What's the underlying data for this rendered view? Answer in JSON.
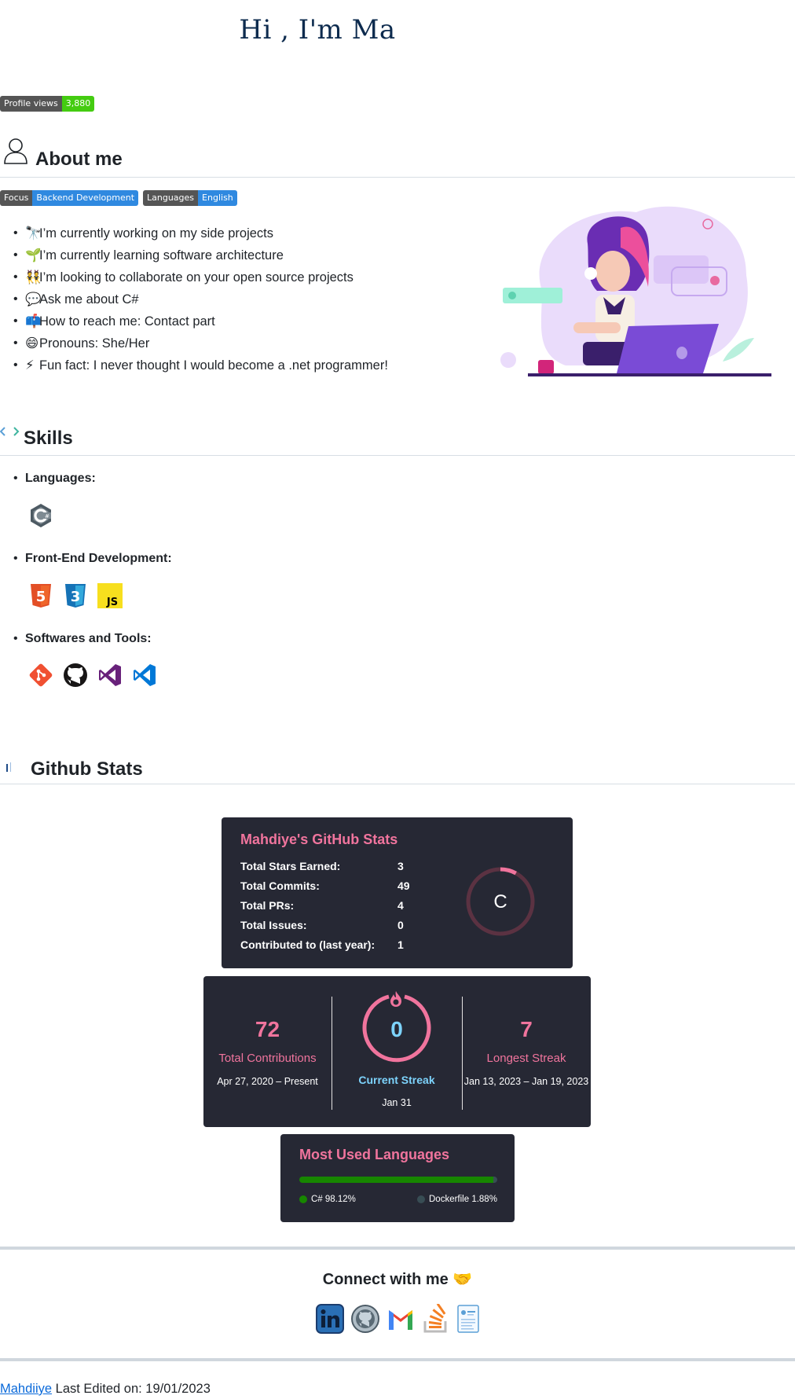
{
  "header": {
    "title": "Hi , I'm Ma"
  },
  "badges": {
    "views_label": "Profile views",
    "views_value": "3,880",
    "focus_label": "Focus",
    "focus_value": "Backend Development",
    "lang_label": "Languages",
    "lang_value": "English"
  },
  "about": {
    "heading": "About me",
    "items": [
      {
        "emoji": "🔭",
        "text": "I’m currently working on my side projects"
      },
      {
        "emoji": "🌱",
        "text": "I’m currently learning software architecture"
      },
      {
        "emoji": "👯",
        "text": "I’m looking to collaborate on your open source projects"
      },
      {
        "emoji": "💬",
        "text": "Ask me about C#"
      },
      {
        "emoji": "📫",
        "text": "How to reach me: Contact part"
      },
      {
        "emoji": "😄",
        "text": "Pronouns: She/Her"
      },
      {
        "emoji": "⚡",
        "text": "Fun fact: I never thought I would become a .net programmer!"
      }
    ]
  },
  "skills": {
    "heading": "Skills",
    "languages_label": "Languages:",
    "frontend_label": "Front-End Development:",
    "tools_label": "Softwares and Tools:",
    "language_icons": [
      "csharp-icon"
    ],
    "frontend_icons": [
      "html5-icon",
      "css3-icon",
      "javascript-icon"
    ],
    "tool_icons": [
      "git-icon",
      "github-icon",
      "visual-studio-icon",
      "vscode-icon"
    ]
  },
  "github": {
    "heading": "Github Stats",
    "stats_card": {
      "title": "Mahdiye's GitHub Stats",
      "rows": [
        {
          "label": "Total Stars Earned:",
          "value": "3"
        },
        {
          "label": "Total Commits:",
          "value": "49"
        },
        {
          "label": "Total PRs:",
          "value": "4"
        },
        {
          "label": "Total Issues:",
          "value": "0"
        },
        {
          "label": "Contributed to (last year):",
          "value": "1"
        }
      ],
      "rank": "C",
      "rank_progress": 0.08
    },
    "streak_card": {
      "total_value": "72",
      "total_label": "Total Contributions",
      "total_range": "Apr 27, 2020 – Present",
      "current_value": "0",
      "current_label": "Current Streak",
      "current_range": "Jan 31",
      "longest_value": "7",
      "longest_label": "Longest Streak",
      "longest_range": "Jan 13, 2023 – Jan 19, 2023"
    },
    "langs_card": {
      "title": "Most Used Languages",
      "langs": [
        {
          "name": "C# 98.12%",
          "percent": 98.12,
          "color": "#178600"
        },
        {
          "name": "Dockerfile 1.88%",
          "percent": 1.88,
          "color": "#384d54"
        }
      ]
    }
  },
  "connect": {
    "heading": "Connect with me 🤝",
    "icons": [
      "linkedin-icon",
      "github-icon",
      "gmail-icon",
      "stackoverflow-icon",
      "resume-icon"
    ]
  },
  "footer": {
    "author": "Mahdiiye",
    "edited": "Last Edited on: 19/01/2023"
  },
  "colors": {
    "card_bg": "#262834",
    "accent": "#f0749d",
    "current_streak": "#7dd3fc",
    "link": "#0969da"
  }
}
